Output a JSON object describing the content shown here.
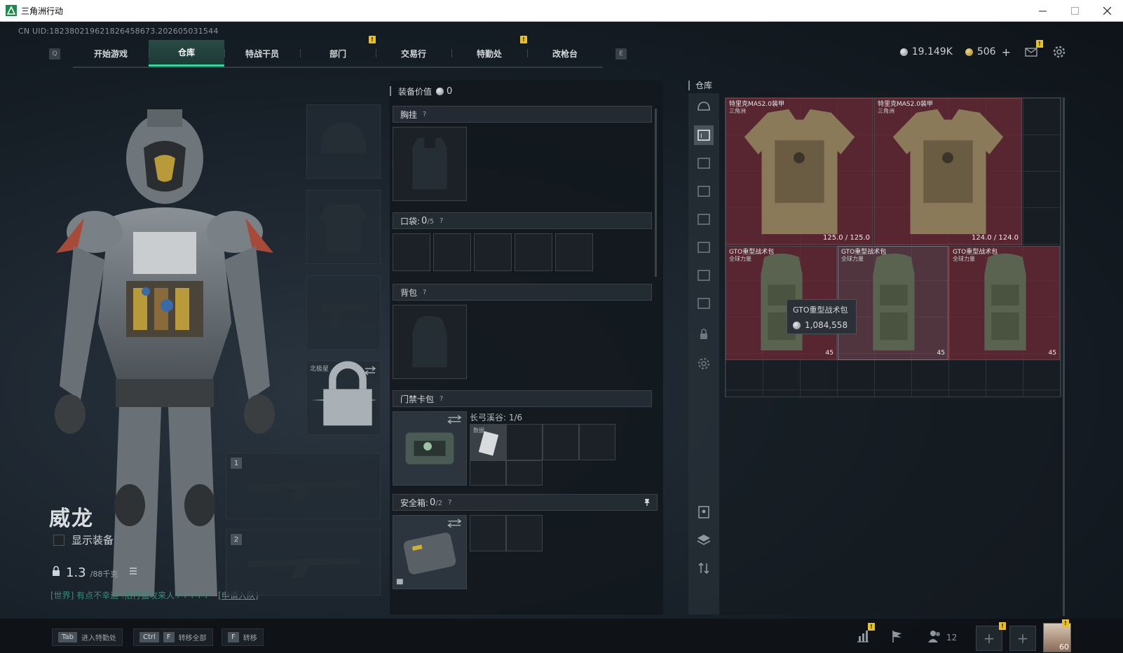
{
  "window": {
    "title": "三角洲行动",
    "minimize": "—",
    "maximize": "☐",
    "close": "✕"
  },
  "uid": "CN UID:1823802196218264586​73.202605031544",
  "nav": {
    "left_key": "Q",
    "right_key": "E",
    "tabs": [
      {
        "label": "开始游戏"
      },
      {
        "label": "仓库",
        "active": true
      },
      {
        "label": "特战干员"
      },
      {
        "label": "部门",
        "notif": "!"
      },
      {
        "label": "交易行"
      },
      {
        "label": "特勤处",
        "notif": "!"
      },
      {
        "label": "改枪台"
      }
    ]
  },
  "currency": {
    "silver": "19.149K",
    "gold": "506",
    "plus": "+",
    "mail_notif": "!"
  },
  "character": {
    "name": "威龙",
    "show_equipment": "显示装备",
    "weight": "1.3",
    "weight_max": "/88千克",
    "chat": "[世界] 有点不幸运 :招行猛攻来人+++++",
    "chat_link": "[申请入队]"
  },
  "left_slots": {
    "melee_label": "北极星",
    "weapon1_num": "1",
    "weapon2_num": "2"
  },
  "equipment": {
    "value_label": "装备价值",
    "value": "0",
    "chest_rig": "胸挂",
    "pockets": "口袋:",
    "pockets_count": "0",
    "pockets_max": "/5",
    "backpack": "背包",
    "keycard": "门禁卡包",
    "keycard_container": "长弓溪谷: 1/6",
    "keycard_item": "数据",
    "safebox": "安全箱:",
    "safebox_count": "0",
    "safebox_max": "/2",
    "help": "?"
  },
  "storage": {
    "title": "仓库",
    "items": [
      {
        "name": "特里克MAS2.0装甲",
        "sub": "三角洲",
        "durability": "125.0 / 125.0"
      },
      {
        "name": "特里克MAS2.0装甲",
        "sub": "三角洲",
        "durability": "124.0 / 124.0"
      },
      {
        "name": "GTO重型战术包",
        "sub": "全球力量",
        "weight": "45"
      },
      {
        "name": "GTO重型战术包",
        "sub": "全球力量",
        "weight": "45"
      },
      {
        "name": "GTO重型战术包",
        "sub": "全球力量",
        "weight": "45"
      }
    ],
    "tooltip": {
      "name": "GTO重型战术包",
      "price": "1,084,558"
    }
  },
  "bottom": {
    "hints": [
      {
        "key": "Tab",
        "label": "进入特勤处"
      },
      {
        "key": "Ctrl",
        "key2": "F",
        "label": "转移全部"
      },
      {
        "key": "F",
        "label": "转移"
      }
    ],
    "friends": "12",
    "level": "60",
    "notif": "!"
  },
  "colors": {
    "accent": "#2fd6a0",
    "item_bg": "#6e2a36",
    "notif": "#e8c02a"
  }
}
